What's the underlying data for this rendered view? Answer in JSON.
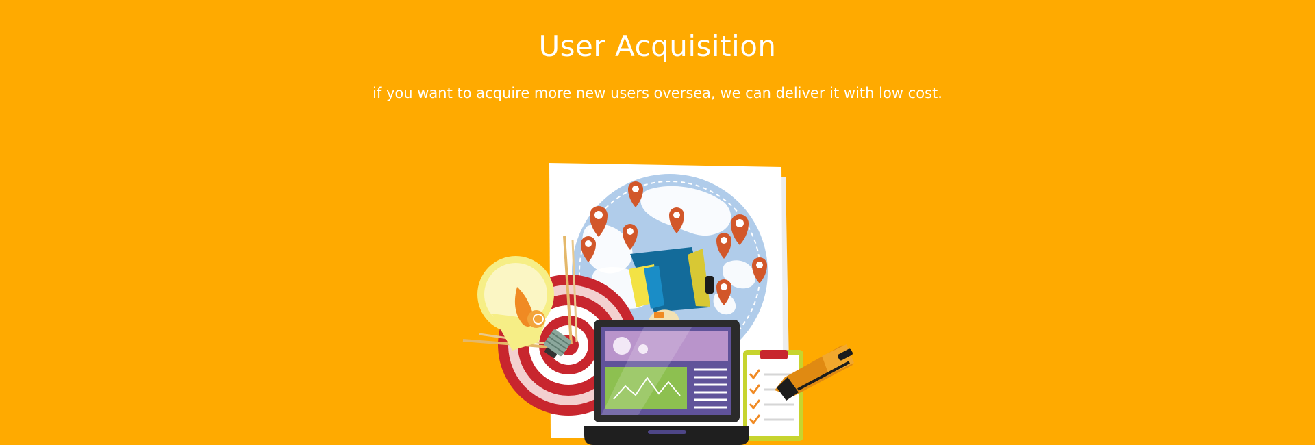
{
  "hero": {
    "title": "User Acquisition",
    "subtitle": "if you want to acquire more new users oversea, we can deliver it with low cost."
  },
  "colors": {
    "background": "#FFAA00",
    "text": "#FFFFFF",
    "map_globe": "#AFCBE9",
    "pin": "#D2572A",
    "target_red": "#C8262E",
    "laptop_frame": "#2B2B2B",
    "laptop_screen_top": "#B994CB",
    "laptop_chart": "#8DC050",
    "clipboard": "#C7D42E",
    "pen": "#E08A12",
    "megaphone": "#136B9A"
  },
  "illustration": {
    "icons": [
      "world-map-icon",
      "location-pin-icon",
      "lightbulb-icon",
      "target-icon",
      "megaphone-icon",
      "laptop-icon",
      "clipboard-checklist-icon",
      "marker-pen-icon"
    ]
  }
}
